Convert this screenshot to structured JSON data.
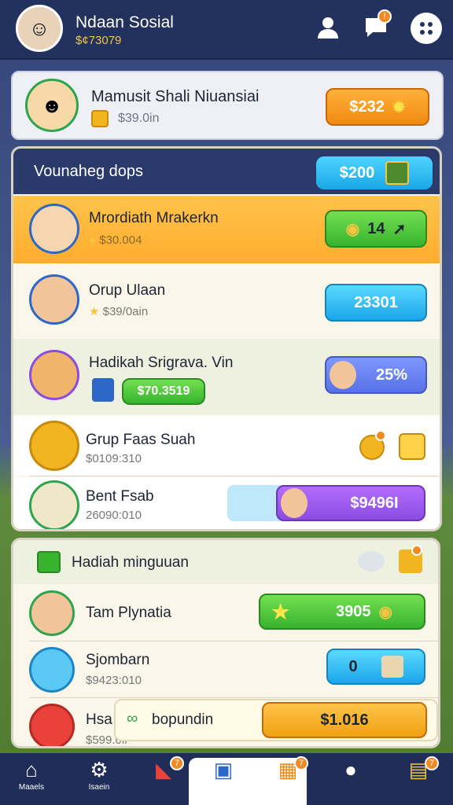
{
  "header": {
    "name": "Ndaan Sosial",
    "coins": "$¢73079",
    "icons": [
      "person-icon",
      "chat-icon",
      "menu-dots-icon"
    ],
    "chat_badge": "!"
  },
  "top_card": {
    "title": "Mamusit Shali Niuansiai",
    "sub": "$39.0in",
    "button": "$232"
  },
  "main_panel": {
    "title": "Vounaheg dops",
    "header_button": "$200",
    "rows": [
      {
        "title": "Mrordiath Mrakerkn",
        "sub": "$30.004",
        "action": "14"
      },
      {
        "title": "Orup Ulaan",
        "sub": "$39/0ain",
        "action": "23301"
      },
      {
        "title": "Hadikah Srigrava. Vin",
        "sub": "$70.3519",
        "action": "25%"
      },
      {
        "title": "Grup Faas Suah",
        "sub": "$0109:310"
      },
      {
        "title": "Bent Fsab",
        "sub": "26090:010",
        "action": "$9496I"
      }
    ]
  },
  "weekly_panel": {
    "title": "Hadiah minguuan",
    "rows": [
      {
        "title": "Tam Plynatia",
        "action": "3905"
      },
      {
        "title": "Sjombarn",
        "sub": "$9423:010",
        "action": "0"
      },
      {
        "title": "Hsa",
        "sub": "$599.0ir"
      }
    ],
    "toast": {
      "label": "bopundin",
      "value": "$1.016"
    }
  },
  "nav": {
    "items": [
      "Maaels",
      "Isaein",
      "",
      "",
      "",
      "",
      ""
    ],
    "badges": [
      "7",
      "7",
      "7"
    ]
  },
  "colors": {
    "header_bg": "#22315e",
    "orange": "#f08a12",
    "green": "#3cbf3a",
    "blue": "#19a7e6",
    "purple": "#8a4de0"
  }
}
